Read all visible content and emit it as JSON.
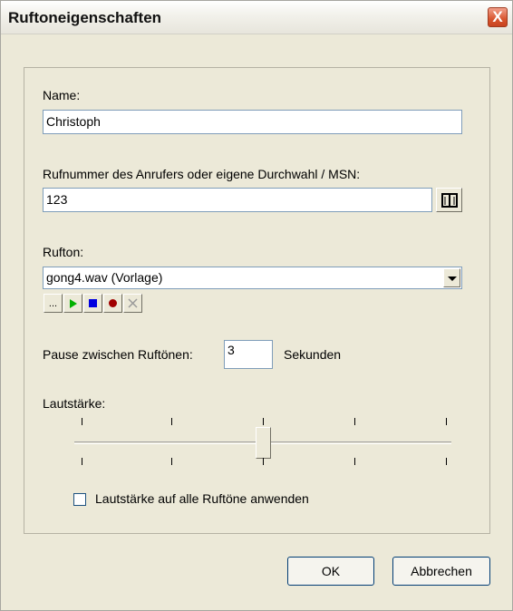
{
  "window": {
    "title": "Ruftoneigenschaften",
    "close_glyph": "X"
  },
  "name": {
    "label": "Name:",
    "value": "Christoph"
  },
  "number": {
    "label": "Rufnummer des Anrufers oder eigene Durchwahl / MSN:",
    "value": "123",
    "icon": "phonebook-icon"
  },
  "ringtone": {
    "label": "Rufton:",
    "selected": "gong4.wav (Vorlage)",
    "buttons": {
      "browse": "...",
      "play_icon": "play-icon",
      "stop_icon": "stop-icon",
      "record_icon": "record-icon",
      "delete_icon": "delete-icon"
    }
  },
  "pause": {
    "label": "Pause zwischen Ruftönen:",
    "value": "3",
    "unit": "Sekunden"
  },
  "volume": {
    "label": "Lautstärke:",
    "level_fraction": 0.5,
    "tick_count": 5
  },
  "apply_all": {
    "label": "Lautstärke auf alle Ruftöne anwenden",
    "checked": false
  },
  "buttons": {
    "ok": "OK",
    "cancel": "Abbrechen"
  }
}
